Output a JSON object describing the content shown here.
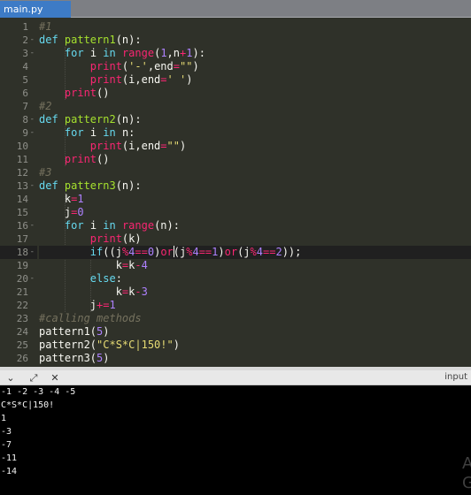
{
  "tab": {
    "label": "main.py"
  },
  "editor": {
    "active_line": 18,
    "gutter": [
      {
        "n": "1",
        "fold": ""
      },
      {
        "n": "2",
        "fold": "-"
      },
      {
        "n": "3",
        "fold": "-"
      },
      {
        "n": "4",
        "fold": ""
      },
      {
        "n": "5",
        "fold": ""
      },
      {
        "n": "6",
        "fold": ""
      },
      {
        "n": "7",
        "fold": ""
      },
      {
        "n": "8",
        "fold": "-"
      },
      {
        "n": "9",
        "fold": "-"
      },
      {
        "n": "10",
        "fold": ""
      },
      {
        "n": "11",
        "fold": ""
      },
      {
        "n": "12",
        "fold": ""
      },
      {
        "n": "13",
        "fold": "-"
      },
      {
        "n": "14",
        "fold": ""
      },
      {
        "n": "15",
        "fold": ""
      },
      {
        "n": "16",
        "fold": "-"
      },
      {
        "n": "17",
        "fold": ""
      },
      {
        "n": "18",
        "fold": "-"
      },
      {
        "n": "19",
        "fold": ""
      },
      {
        "n": "20",
        "fold": "-"
      },
      {
        "n": "21",
        "fold": ""
      },
      {
        "n": "22",
        "fold": ""
      },
      {
        "n": "23",
        "fold": ""
      },
      {
        "n": "24",
        "fold": ""
      },
      {
        "n": "25",
        "fold": ""
      },
      {
        "n": "26",
        "fold": ""
      }
    ],
    "lines": [
      [
        [
          "cmt",
          "#1"
        ]
      ],
      [
        [
          "kw",
          "def "
        ],
        [
          "fn",
          "pattern1"
        ],
        [
          "",
          "(n):"
        ]
      ],
      [
        [
          "",
          "    "
        ],
        [
          "kw",
          "for "
        ],
        [
          "",
          "i "
        ],
        [
          "kw",
          "in "
        ],
        [
          "bi",
          "range"
        ],
        [
          "",
          "("
        ],
        [
          "num-lit",
          "1"
        ],
        [
          "",
          ",n"
        ],
        [
          "op",
          "+"
        ],
        [
          "num-lit",
          "1"
        ],
        [
          "",
          "):"
        ]
      ],
      [
        [
          "",
          "        "
        ],
        [
          "bi",
          "print"
        ],
        [
          "",
          "("
        ],
        [
          "str",
          "'-'"
        ],
        [
          "",
          ",end"
        ],
        [
          "op",
          "="
        ],
        [
          "str",
          "\"\""
        ],
        [
          "",
          ")"
        ]
      ],
      [
        [
          "",
          "        "
        ],
        [
          "bi",
          "print"
        ],
        [
          "",
          "(i,end"
        ],
        [
          "op",
          "="
        ],
        [
          "str",
          "' '"
        ],
        [
          "",
          ")"
        ]
      ],
      [
        [
          "",
          "    "
        ],
        [
          "bi",
          "print"
        ],
        [
          "",
          "()"
        ]
      ],
      [
        [
          "cmt",
          "#2"
        ]
      ],
      [
        [
          "kw",
          "def "
        ],
        [
          "fn",
          "pattern2"
        ],
        [
          "",
          "(n):"
        ]
      ],
      [
        [
          "",
          "    "
        ],
        [
          "kw",
          "for "
        ],
        [
          "",
          "i "
        ],
        [
          "kw",
          "in "
        ],
        [
          "",
          "n:"
        ]
      ],
      [
        [
          "",
          "        "
        ],
        [
          "bi",
          "print"
        ],
        [
          "",
          "(i,end"
        ],
        [
          "op",
          "="
        ],
        [
          "str",
          "\"\""
        ],
        [
          "",
          ")"
        ]
      ],
      [
        [
          "",
          "    "
        ],
        [
          "bi",
          "print"
        ],
        [
          "",
          "()"
        ]
      ],
      [
        [
          "cmt",
          "#3"
        ]
      ],
      [
        [
          "kw",
          "def "
        ],
        [
          "fn",
          "pattern3"
        ],
        [
          "",
          "(n):"
        ]
      ],
      [
        [
          "",
          "    k"
        ],
        [
          "op",
          "="
        ],
        [
          "num-lit",
          "1"
        ]
      ],
      [
        [
          "",
          "    j"
        ],
        [
          "op",
          "="
        ],
        [
          "num-lit",
          "0"
        ]
      ],
      [
        [
          "",
          "    "
        ],
        [
          "kw",
          "for "
        ],
        [
          "",
          "i "
        ],
        [
          "kw",
          "in "
        ],
        [
          "bi",
          "range"
        ],
        [
          "",
          "(n):"
        ]
      ],
      [
        [
          "",
          "        "
        ],
        [
          "bi",
          "print"
        ],
        [
          "",
          "(k)"
        ]
      ],
      [
        [
          "",
          "        "
        ],
        [
          "kw",
          "if"
        ],
        [
          "",
          "((j"
        ],
        [
          "op",
          "%"
        ],
        [
          "num-lit",
          "4"
        ],
        [
          "op",
          "=="
        ],
        [
          "num-lit",
          "0"
        ],
        [
          "",
          ")"
        ],
        [
          "k2",
          "or"
        ],
        [
          "cursor",
          ""
        ],
        [
          "",
          "(j"
        ],
        [
          "op",
          "%"
        ],
        [
          "num-lit",
          "4"
        ],
        [
          "op",
          "=="
        ],
        [
          "num-lit",
          "1"
        ],
        [
          "",
          ")"
        ],
        [
          "k2",
          "or"
        ],
        [
          "",
          "(j"
        ],
        [
          "op",
          "%"
        ],
        [
          "num-lit",
          "4"
        ],
        [
          "op",
          "=="
        ],
        [
          "num-lit",
          "2"
        ],
        [
          "",
          "));"
        ]
      ],
      [
        [
          "",
          "            k"
        ],
        [
          "op",
          "="
        ],
        [
          "",
          "k"
        ],
        [
          "op",
          "-"
        ],
        [
          "num-lit",
          "4"
        ]
      ],
      [
        [
          "",
          "        "
        ],
        [
          "kw",
          "else"
        ],
        [
          "",
          ":"
        ]
      ],
      [
        [
          "",
          "            k"
        ],
        [
          "op",
          "="
        ],
        [
          "",
          "k"
        ],
        [
          "op",
          "-"
        ],
        [
          "num-lit",
          "3"
        ]
      ],
      [
        [
          "",
          "        j"
        ],
        [
          "op",
          "+="
        ],
        [
          "num-lit",
          "1"
        ]
      ],
      [
        [
          "cmt",
          "#calling methods"
        ]
      ],
      [
        [
          "",
          "pattern1("
        ],
        [
          "num-lit",
          "5"
        ],
        [
          "",
          ")"
        ]
      ],
      [
        [
          "",
          "pattern2("
        ],
        [
          "str",
          "\"C*S*C|150!\""
        ],
        [
          "",
          ")"
        ]
      ],
      [
        [
          "",
          "pattern3("
        ],
        [
          "num-lit",
          "5"
        ],
        [
          "",
          ")"
        ]
      ]
    ]
  },
  "console": {
    "toolbar": {
      "collapse_icon": "chevron-down-icon",
      "expand_icon": "expand-arrows-icon",
      "clear_icon": "clear-console-icon",
      "input_label": "input"
    },
    "output_lines": [
      "-1 -2 -3 -4 -5 ",
      "C*S*C|150!",
      "1",
      "-3",
      "-7",
      "-11",
      "-14"
    ],
    "watermark": "A\nG"
  }
}
